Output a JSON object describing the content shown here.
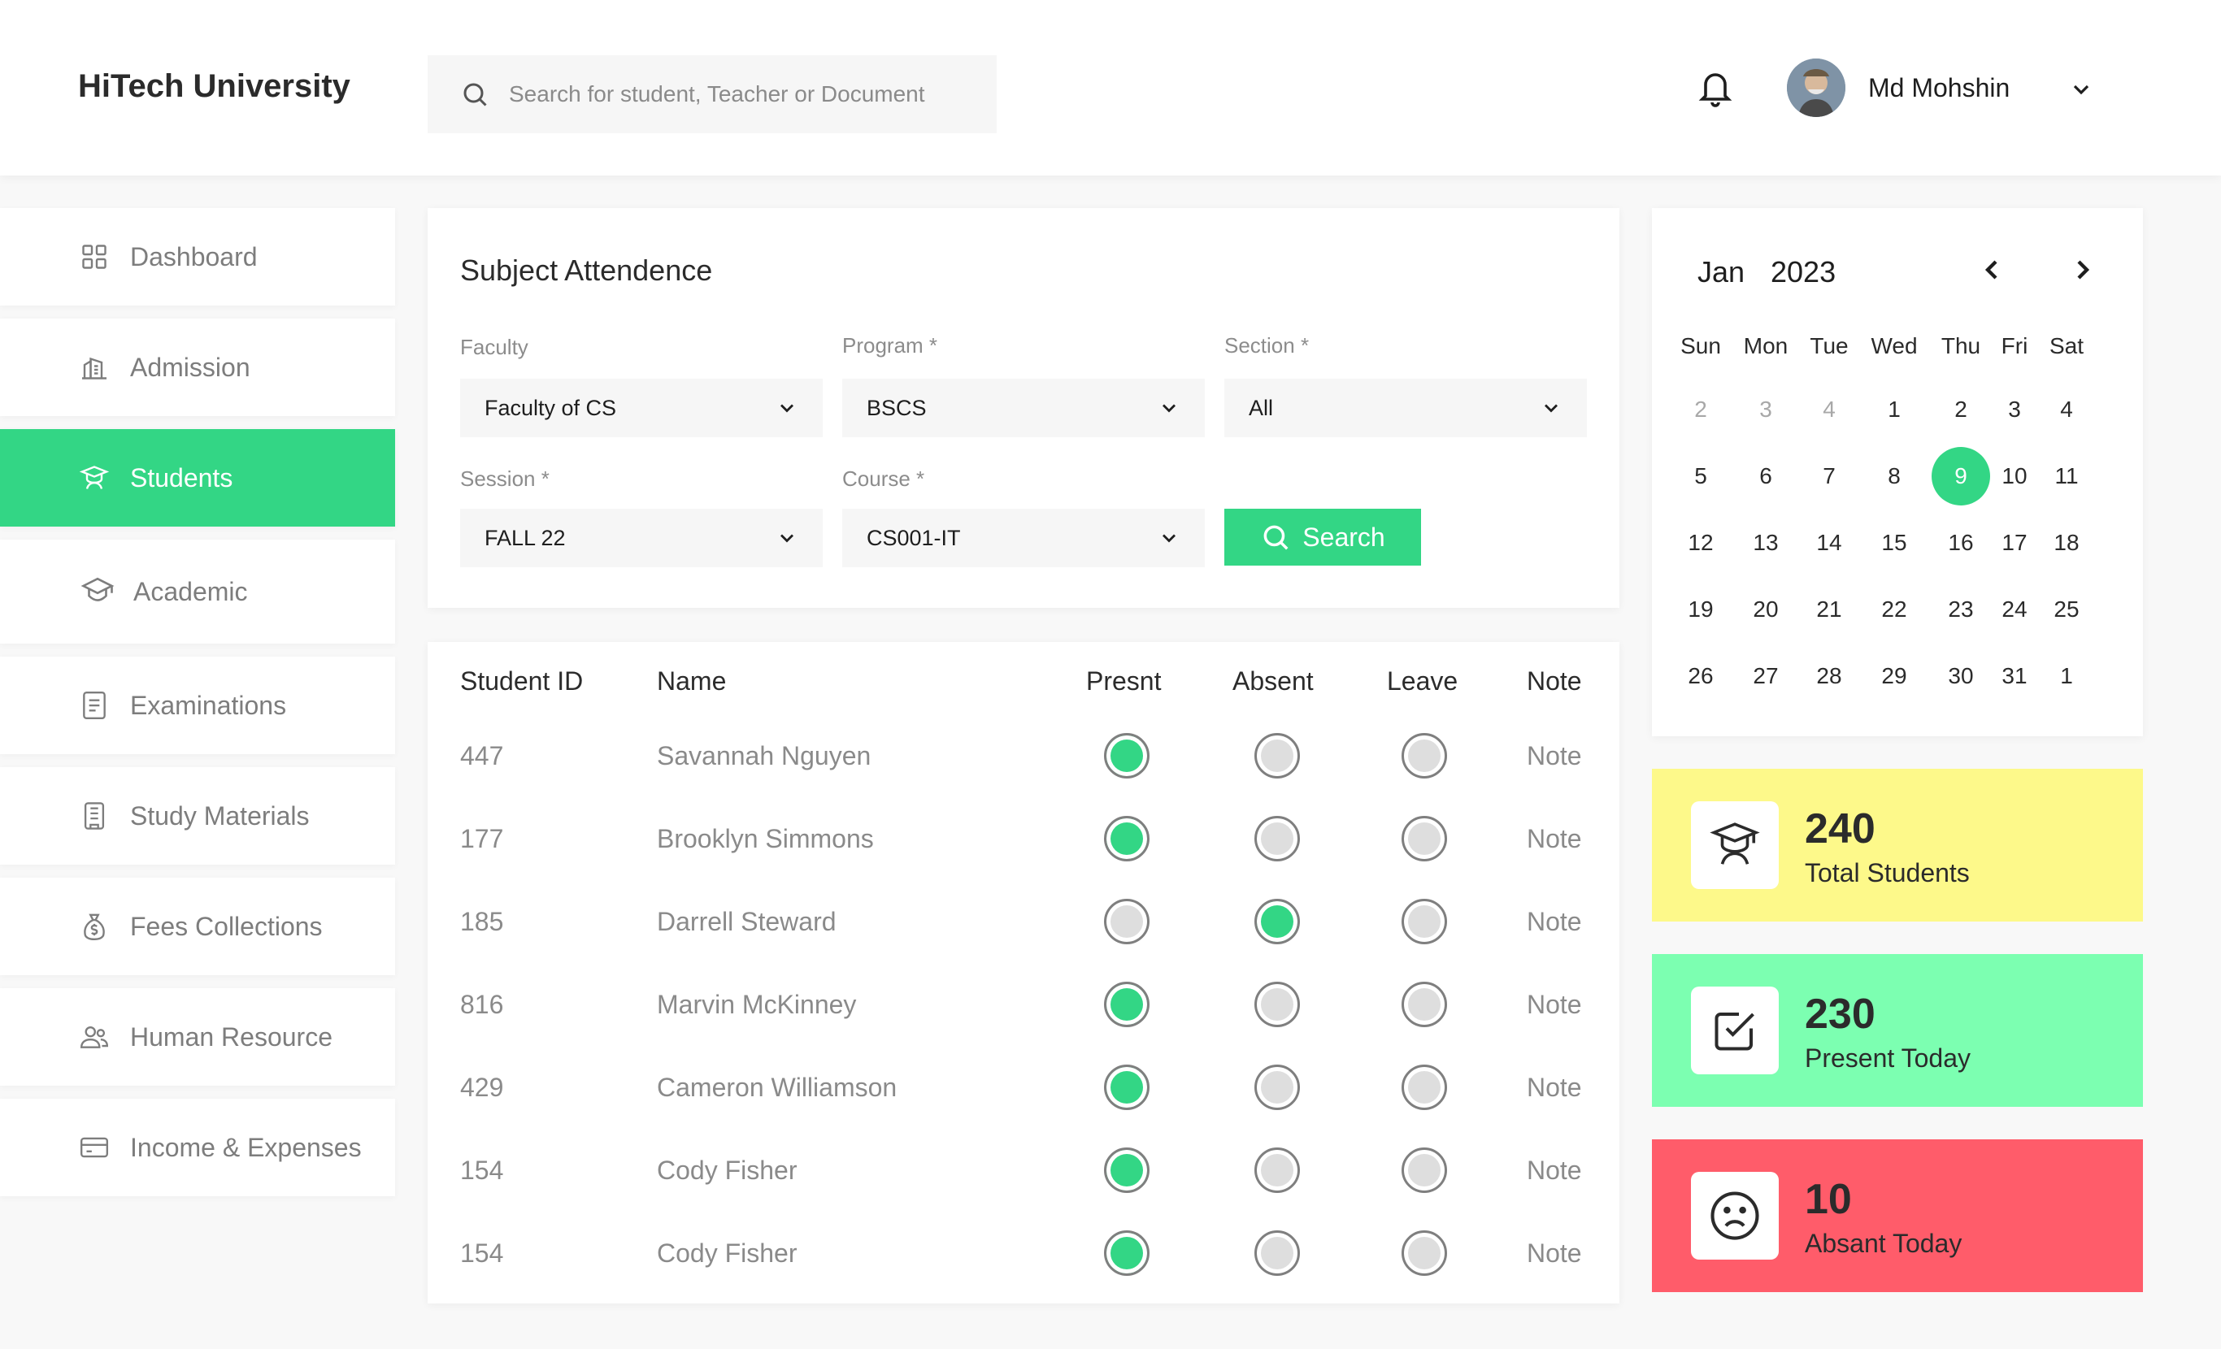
{
  "header": {
    "brand": "HiTech University",
    "search_placeholder": "Search for student, Teacher or Document",
    "user_name": "Md Mohshin"
  },
  "sidebar": {
    "items": [
      {
        "label": "Dashboard",
        "icon": "grid-icon"
      },
      {
        "label": "Admission",
        "icon": "building-icon"
      },
      {
        "label": "Students",
        "icon": "student-icon",
        "active": true
      },
      {
        "label": "Academic",
        "icon": "graduation-cap-icon"
      },
      {
        "label": "Examinations",
        "icon": "document-icon"
      },
      {
        "label": "Study Materials",
        "icon": "book-icon"
      },
      {
        "label": "Fees Collections",
        "icon": "money-bag-icon"
      },
      {
        "label": "Human Resource",
        "icon": "people-icon"
      },
      {
        "label": "Income & Expenses",
        "icon": "card-icon"
      }
    ]
  },
  "attendance": {
    "title": "Subject Attendence",
    "filters": {
      "faculty": {
        "label": "Faculty",
        "value": "Faculty of CS"
      },
      "program": {
        "label": "Program *",
        "value": "BSCS"
      },
      "section": {
        "label": "Section *",
        "value": "All"
      },
      "session": {
        "label": "Session *",
        "value": "FALL 22"
      },
      "course": {
        "label": "Course *",
        "value": "CS001-IT"
      }
    },
    "search_label": "Search"
  },
  "table": {
    "headers": {
      "id": "Student ID",
      "name": "Name",
      "present": "Presnt",
      "absent": "Absent",
      "leave": "Leave",
      "note": "Note"
    },
    "rows": [
      {
        "id": "447",
        "name": "Savannah Nguyen",
        "status": "present",
        "note": "Note"
      },
      {
        "id": "177",
        "name": "Brooklyn Simmons",
        "status": "present",
        "note": "Note"
      },
      {
        "id": "185",
        "name": "Darrell Steward",
        "status": "absent",
        "note": "Note"
      },
      {
        "id": "816",
        "name": "Marvin McKinney",
        "status": "present",
        "note": "Note"
      },
      {
        "id": "429",
        "name": "Cameron Williamson",
        "status": "present",
        "note": "Note"
      },
      {
        "id": "154",
        "name": "Cody Fisher",
        "status": "present",
        "note": "Note"
      },
      {
        "id": "154",
        "name": "Cody Fisher",
        "status": "present",
        "note": "Note"
      }
    ]
  },
  "calendar": {
    "month": "Jan",
    "year": "2023",
    "weekdays": [
      "Sun",
      "Mon",
      "Tue",
      "Wed",
      "Thu",
      "Fri",
      "Sat"
    ],
    "weeks": [
      [
        {
          "d": "2",
          "m": true
        },
        {
          "d": "3",
          "m": true
        },
        {
          "d": "4",
          "m": true
        },
        {
          "d": "1"
        },
        {
          "d": "2"
        },
        {
          "d": "3"
        },
        {
          "d": "4"
        }
      ],
      [
        {
          "d": "5"
        },
        {
          "d": "6"
        },
        {
          "d": "7"
        },
        {
          "d": "8"
        },
        {
          "d": "9",
          "today": true
        },
        {
          "d": "10"
        },
        {
          "d": "11"
        }
      ],
      [
        {
          "d": "12"
        },
        {
          "d": "13"
        },
        {
          "d": "14"
        },
        {
          "d": "15"
        },
        {
          "d": "16"
        },
        {
          "d": "17"
        },
        {
          "d": "18"
        }
      ],
      [
        {
          "d": "19"
        },
        {
          "d": "20"
        },
        {
          "d": "21"
        },
        {
          "d": "22"
        },
        {
          "d": "23"
        },
        {
          "d": "24"
        },
        {
          "d": "25"
        }
      ],
      [
        {
          "d": "26"
        },
        {
          "d": "27"
        },
        {
          "d": "28"
        },
        {
          "d": "29"
        },
        {
          "d": "30"
        },
        {
          "d": "31"
        },
        {
          "d": "1"
        }
      ]
    ]
  },
  "stats": {
    "total": {
      "value": "240",
      "label": "Total Students",
      "color": "#fdf98a"
    },
    "present": {
      "value": "230",
      "label": "Present Today",
      "color": "#7cffb1"
    },
    "absent": {
      "value": "10",
      "label": "Absant Today",
      "color": "#ff5c6a"
    }
  },
  "colors": {
    "accent": "#33d685"
  }
}
